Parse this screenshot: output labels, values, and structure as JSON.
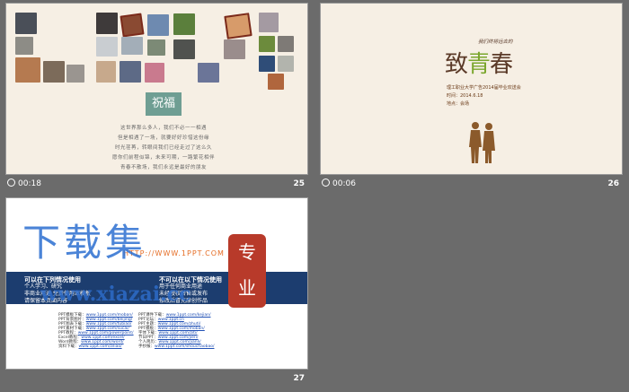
{
  "slides": [
    {
      "timer": "00:18",
      "number": "25"
    },
    {
      "timer": "00:06",
      "number": "26"
    },
    {
      "timer": "",
      "number": "27"
    }
  ],
  "slide25": {
    "blessing": "祝福",
    "poem": [
      "这世界那么多人，我们不必一一相遇",
      "但是相遇了一场，就要好好珍惜这份缘",
      "时光荏苒，转眼间我们已经走过了这么久",
      "愿你们前程似锦，未来可期，一路繁花相伴",
      "青春不散场，我们永远是最好的朋友"
    ]
  },
  "slide26": {
    "subtitle": "我们终将远去的",
    "title_a": "致",
    "title_b": "青",
    "title_c": "春",
    "info": [
      "理工职业大学广告2014届毕业欢送会",
      "时间：2014.6.18",
      "地点：会场"
    ]
  },
  "slide27": {
    "watermark_top": "下载集",
    "watermark_bottom": "www.xiazai.cc",
    "stamp_line1": "专",
    "stamp_line2": "业",
    "url_strip": "HTTP://WWW.1PPT.COM",
    "left_title": "可以在下列情况使用",
    "left_lines": [
      "个人学习、研究",
      "非商业用途 免费使用本模板",
      "请保留本页面内容"
    ],
    "right_title": "不可以在以下情况使用",
    "right_lines": [
      "用于任何商业用途",
      "未经授权转售或发布",
      "修改后冒充原创作品"
    ],
    "link_labels": [
      "PPT模板下载：",
      "PPT背景图片：",
      "PPT图表下载：",
      "PPT素材下载：",
      "PPT教程：",
      "Excel教程：",
      "Word教程：",
      "资料下载："
    ],
    "link_urls": [
      "www.1ppt.com/moban/",
      "www.1ppt.com/beijing/",
      "www.1ppt.com/tubiao/",
      "www.1ppt.com/sucai/",
      "www.1ppt.com/powerpoint/",
      "www.1ppt.com/excel/",
      "www.1ppt.com/word/",
      "www.1ppt.com/ziliao/"
    ],
    "link_labels2": [
      "PPT课件下载：",
      "PPT论坛：",
      "PPT主题：",
      "PPT模板：",
      "字体下载：",
      "节日PPT：",
      "个人简历：",
      "手抄报："
    ],
    "link_urls2": [
      "www.1ppt.com/kejian/",
      "www.1ppt.cn",
      "www.1ppt.com/zhuti/",
      "www.1ppt.com/moban/",
      "www.1ppt.com/ziti/",
      "www.1ppt.com/jieri/",
      "www.1ppt.com/jianli/",
      "www.1ppt.com/shouchaobao/"
    ]
  },
  "colors": {
    "background": "#6b6b6b",
    "slide_cream": "#f6efe4",
    "blessing_green": "#6f9e93",
    "band_blue": "#1c3d6f",
    "stamp_red": "#b83a2a",
    "watermark_blue": "#2c6fd1"
  },
  "icons": {
    "timer": "clock-icon"
  }
}
